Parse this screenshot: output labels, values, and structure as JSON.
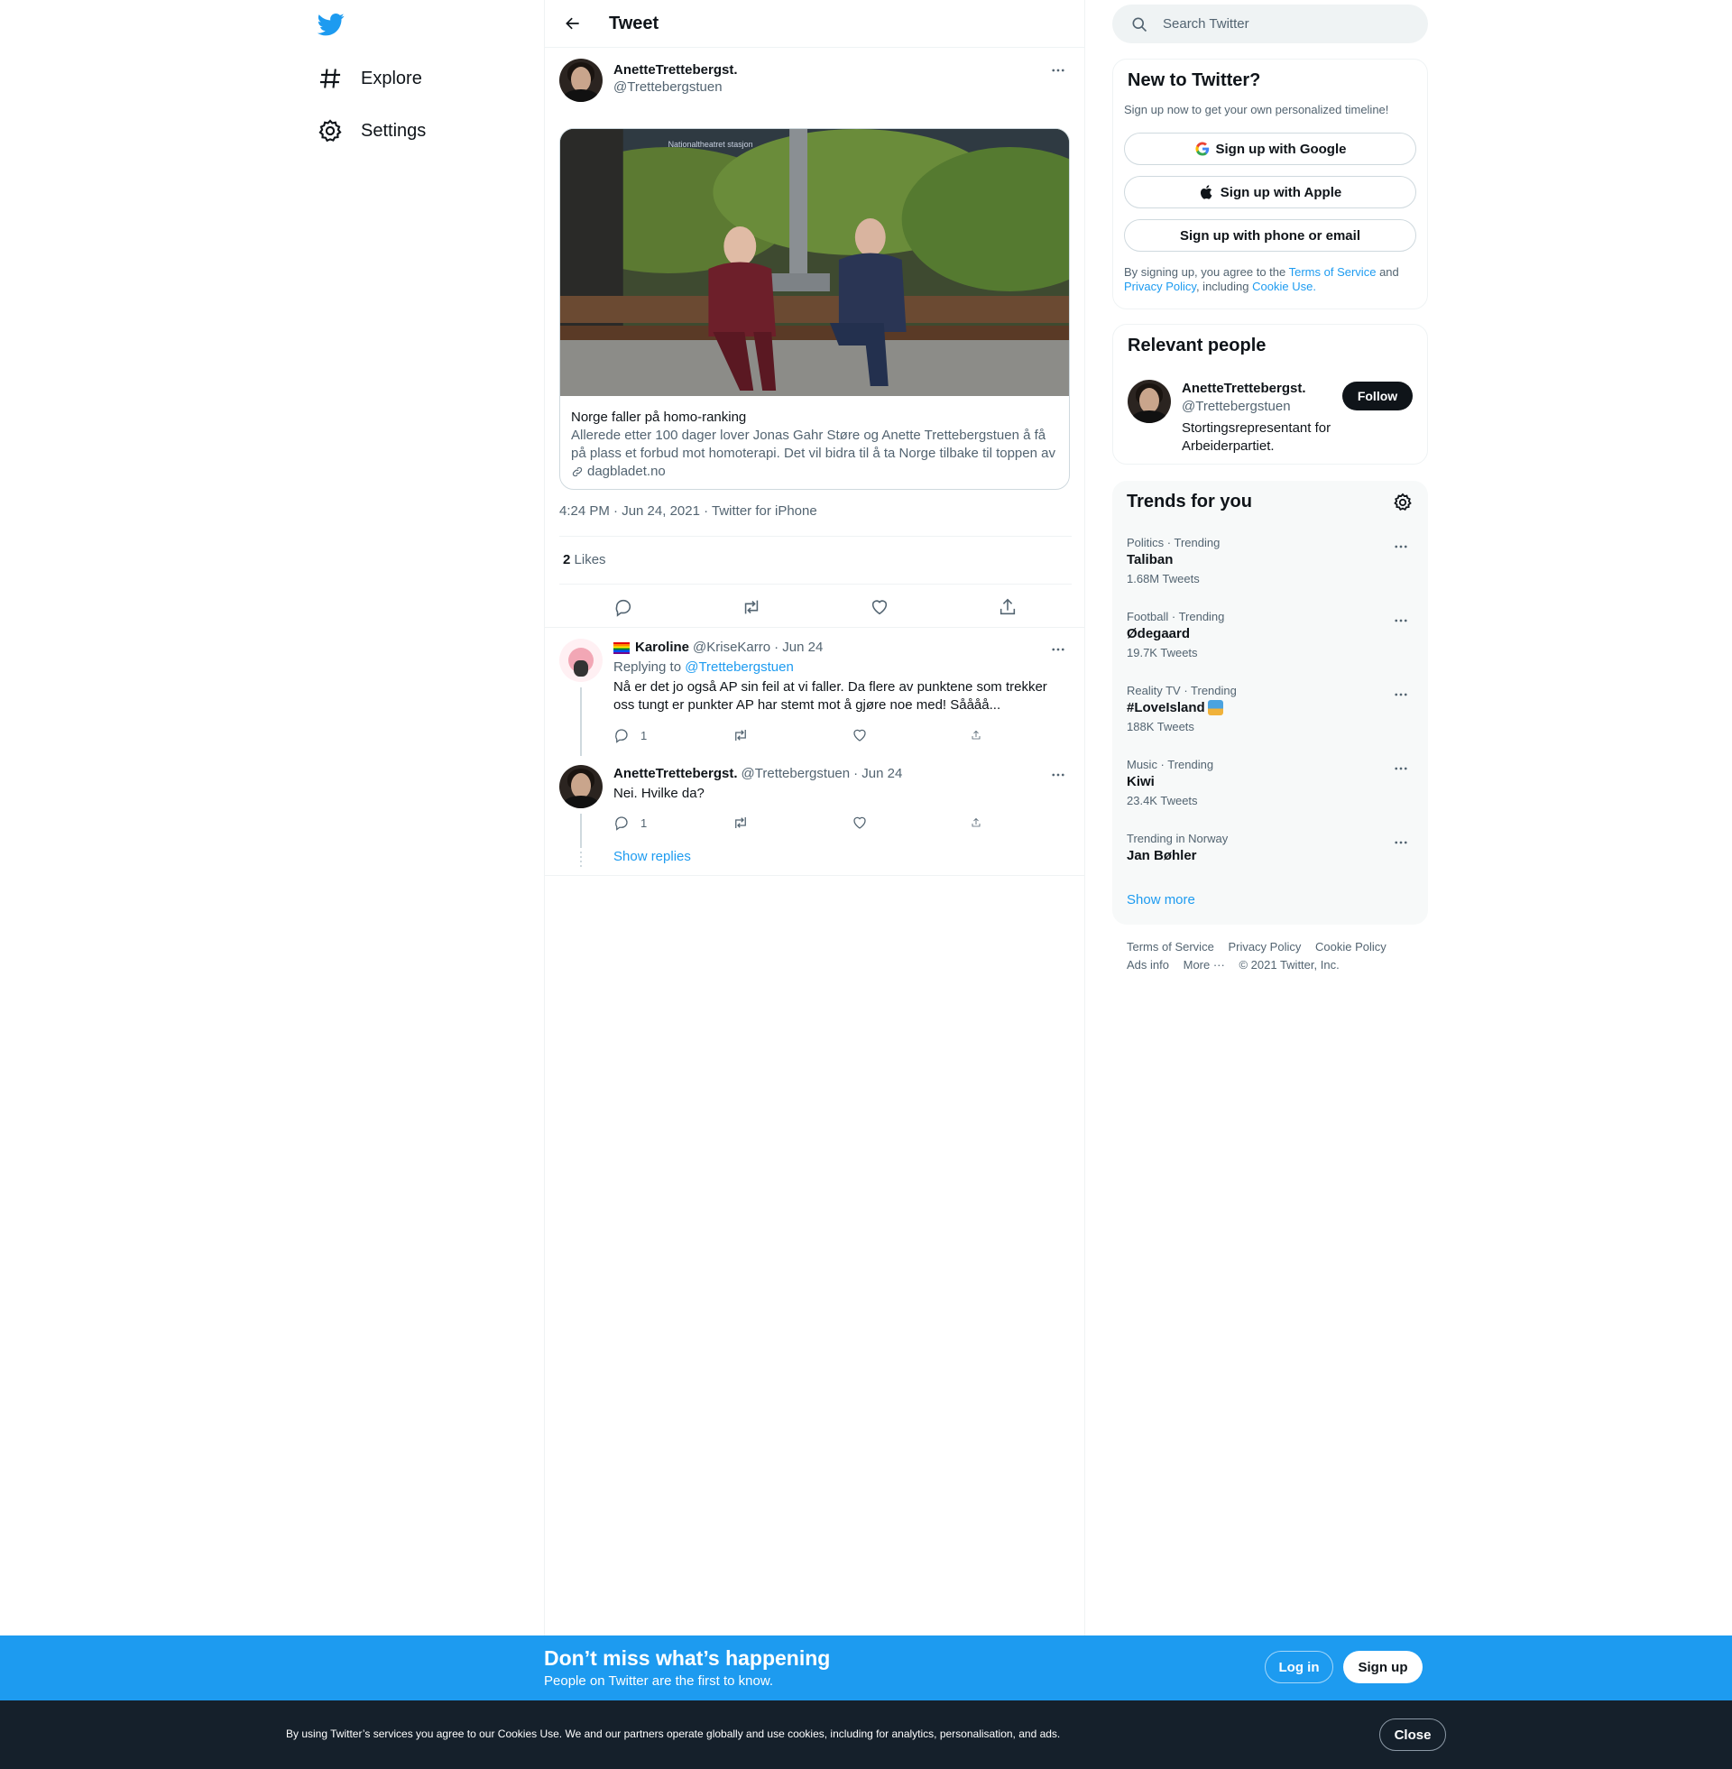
{
  "nav": {
    "logo": "twitter-bird-icon",
    "items": [
      {
        "label": "Explore",
        "icon": "hashtag-icon"
      },
      {
        "label": "Settings",
        "icon": "gear-icon"
      }
    ]
  },
  "header": {
    "title": "Tweet"
  },
  "tweet": {
    "author_name": "AnetteTrettebergst.",
    "author_handle": "@Trettebergstuen",
    "card": {
      "title": "Norge faller på homo-ranking",
      "description": "Allerede etter 100 dager lover Jonas Gahr Støre og Anette Trettebergstuen å få på plass et forbud mot homoterapi. Det vil bidra til å ta Norge tilbake til toppen av ...",
      "domain": "dagbladet.no",
      "image_text": "Nationaltheatret stasjon"
    },
    "timestamp": "4:24 PM · Jun 24, 2021 · Twitter for iPhone",
    "likes_count": "2",
    "likes_label": "Likes"
  },
  "replies": [
    {
      "name": "Karoline",
      "handle": "@KriseKarro",
      "date": "· Jun 24",
      "replying_prefix": "Replying to",
      "replying_to": "@Trettebergstuen",
      "text": "Nå er det jo også AP sin feil at vi faller. Da flere av punktene som trekker oss tungt er punkter AP har stemt mot å gjøre noe med! Såååå...",
      "reply_count": "1"
    },
    {
      "name": "AnetteTrettebergst.",
      "handle": "@Trettebergstuen",
      "date": "· Jun 24",
      "text": "Nei. Hvilke da?",
      "reply_count": "1",
      "show_replies": "Show replies"
    }
  ],
  "search": {
    "placeholder": "Search Twitter"
  },
  "new_to_twitter": {
    "title": "New to Twitter?",
    "subtitle": "Sign up now to get your own personalized timeline!",
    "google": "Sign up with Google",
    "apple": "Sign up with Apple",
    "phone": "Sign up with phone or email",
    "legal_1": "By signing up, you agree to the",
    "terms": "Terms of Service",
    "and": "and",
    "privacy": "Privacy Policy",
    "including": ", including",
    "cookie": "Cookie Use."
  },
  "relevant": {
    "title": "Relevant people",
    "name": "AnetteTrettebergst.",
    "handle": "@Trettebergstuen",
    "bio": "Stortingsrepresentant for Arbeiderpartiet.",
    "follow": "Follow"
  },
  "trends": {
    "title": "Trends for you",
    "items": [
      {
        "category": "Politics · Trending",
        "name": "Taliban",
        "count": "1.68M Tweets"
      },
      {
        "category": "Football · Trending",
        "name": "Ødegaard",
        "count": "19.7K Tweets"
      },
      {
        "category": "Reality TV · Trending",
        "name": "#LoveIsland",
        "count": "188K Tweets"
      },
      {
        "category": "Music · Trending",
        "name": "Kiwi",
        "count": "23.4K Tweets"
      },
      {
        "category": "Trending in Norway",
        "name": "Jan Bøhler",
        "count": ""
      }
    ],
    "show_more": "Show more"
  },
  "footer": {
    "terms": "Terms of Service",
    "privacy": "Privacy Policy",
    "cookie": "Cookie Policy",
    "ads": "Ads info",
    "more": "More ···",
    "copyright": "© 2021 Twitter, Inc."
  },
  "banner": {
    "title": "Don’t miss what’s happening",
    "subtitle": "People on Twitter are the first to know.",
    "login": "Log in",
    "signup": "Sign up"
  },
  "cookie_bar": {
    "text": "By using Twitter’s services you agree to our Cookies Use. We and our partners operate globally and use cookies, including for analytics, personalisation, and ads.",
    "close": "Close"
  },
  "colors": {
    "accent": "#1d9bf0",
    "text": "#0f1419",
    "muted": "#536471",
    "dark_bar": "#15202b"
  }
}
